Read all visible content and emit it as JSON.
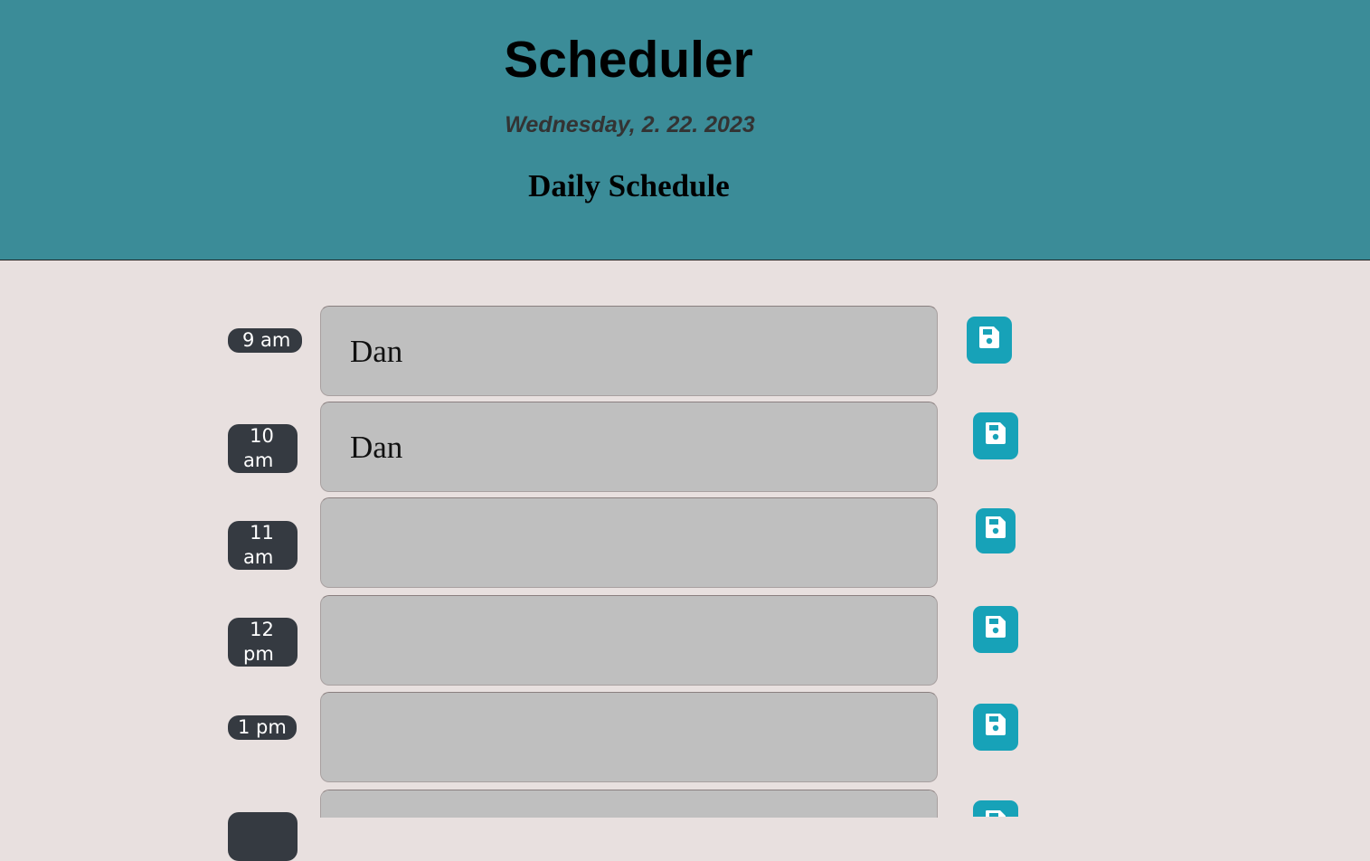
{
  "header": {
    "title": "Scheduler",
    "date": "Wednesday, 2. 22. 2023",
    "subtitle": "Daily Schedule"
  },
  "rows": [
    {
      "hour_line1": "9 am",
      "hour_line2": "",
      "event": "Dan"
    },
    {
      "hour_line1": "10",
      "hour_line2": "am",
      "event": "Dan"
    },
    {
      "hour_line1": "11",
      "hour_line2": "am",
      "event": ""
    },
    {
      "hour_line1": "12",
      "hour_line2": "pm",
      "event": ""
    },
    {
      "hour_line1": "1 pm",
      "hour_line2": "",
      "event": ""
    },
    {
      "hour_line1": "",
      "hour_line2": "",
      "event": ""
    }
  ],
  "save_icon": "floppy-disk-icon",
  "colors": {
    "header_bg": "#3b8c98",
    "page_bg": "#e8e0df",
    "hour_badge": "#353a41",
    "event_bg": "#bfbfbf",
    "save_button": "#17a2b8"
  }
}
